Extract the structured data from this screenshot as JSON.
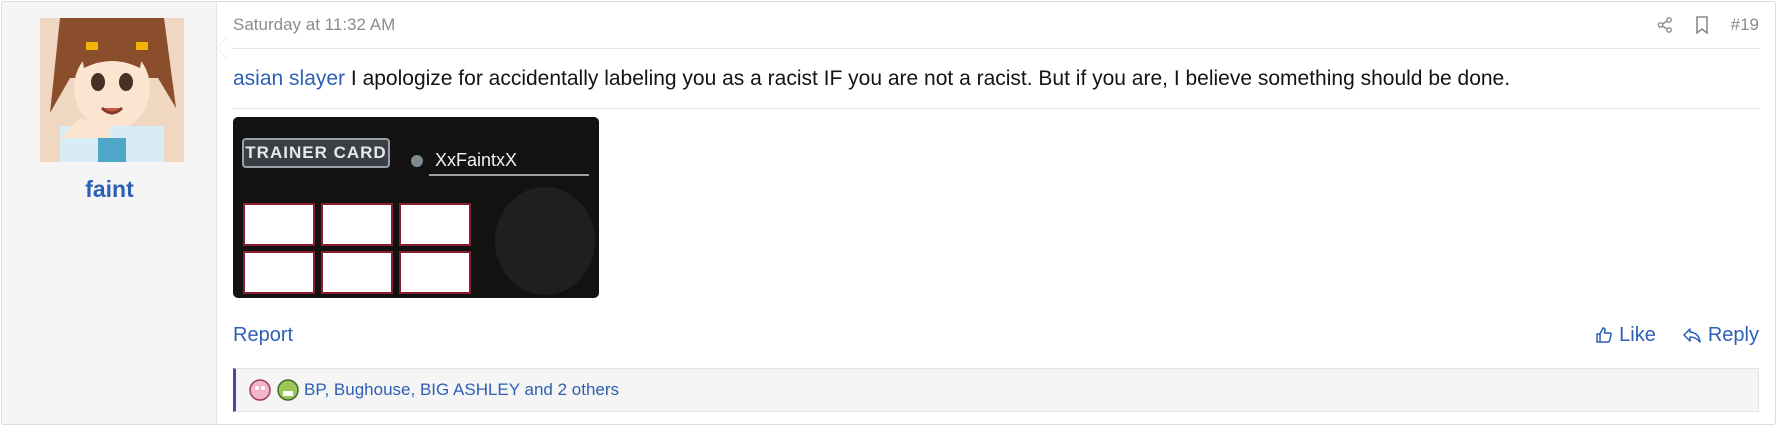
{
  "post": {
    "date": "Saturday at 11:32 AM",
    "number": "#19",
    "icons": {
      "share": "share-icon",
      "bookmark": "bookmark-icon"
    }
  },
  "user": {
    "name": "faint",
    "avatar": "avatar-image"
  },
  "message": {
    "mention": "asian slayer",
    "text": " I apologize for accidentally labeling you as a racist IF you are not a racist. But if you are, I believe something should be done."
  },
  "signature": {
    "title": "TRAINER CARD",
    "trainer_name": "XxFaintxX"
  },
  "actions": {
    "report": "Report",
    "like": "Like",
    "reply": "Reply"
  },
  "reactions": {
    "text": "BP, Bughouse, BIG ASHLEY and 2 others"
  },
  "colors": {
    "link": "#2d5fb5",
    "reaction_border": "#4a4a9f"
  }
}
